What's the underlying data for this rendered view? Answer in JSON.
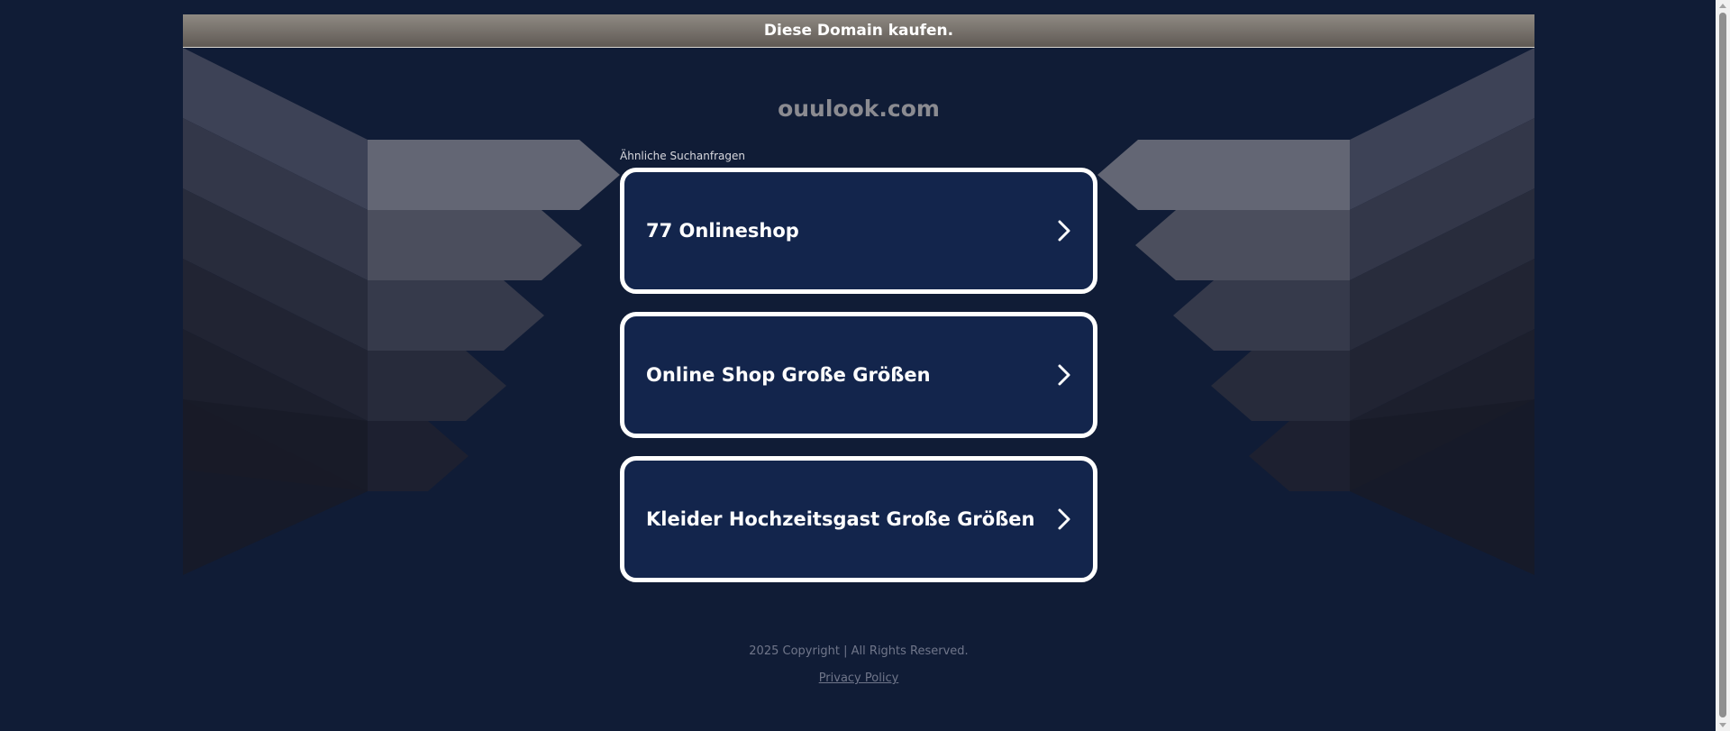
{
  "banner": {
    "label": "Diese Domain kaufen."
  },
  "domain": {
    "name": "ouulook.com"
  },
  "related": {
    "label": "Ähnliche Suchanfragen",
    "items": [
      {
        "label": "77 Onlineshop"
      },
      {
        "label": "Online Shop Große Größen"
      },
      {
        "label": "Kleider Hochzeitsgast Große Größen"
      }
    ]
  },
  "footer": {
    "copyright": "2025 Copyright | All Rights Reserved.",
    "privacy_label": "Privacy Policy"
  },
  "icons": {
    "result_chevron": "chevron-right-icon"
  },
  "colors": {
    "background": "#101c36",
    "card_background": "#13254c",
    "card_border": "#ffffff",
    "banner_top": "#8f8a83",
    "banner_bottom": "#5f5954"
  }
}
